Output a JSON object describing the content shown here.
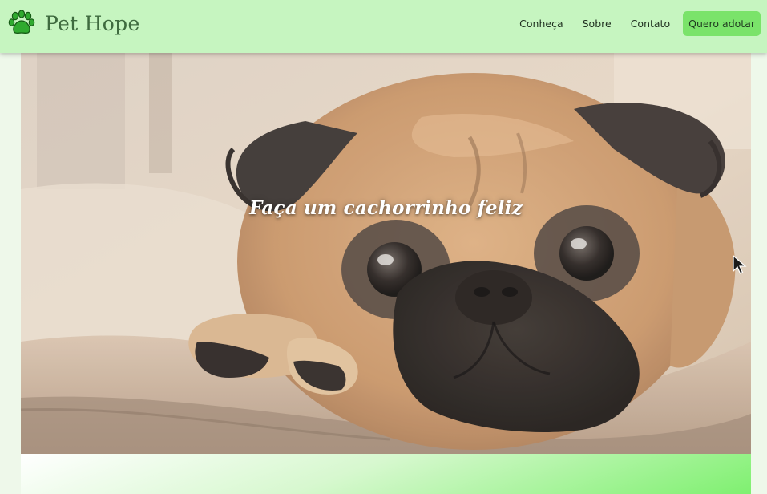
{
  "brand": {
    "icon": "paw-icon",
    "name": "Pet Hope"
  },
  "nav": {
    "links": [
      "Conheça",
      "Sobre",
      "Contato"
    ],
    "cta": "Quero adotar"
  },
  "hero": {
    "image": "pug-photo",
    "title": "Faça um cachorrinho feliz"
  },
  "colors": {
    "navbar": "#c6f5c0",
    "cta": "#7ae36a",
    "brand_text": "#3f6b3f",
    "page_background": "#eef8ea"
  }
}
